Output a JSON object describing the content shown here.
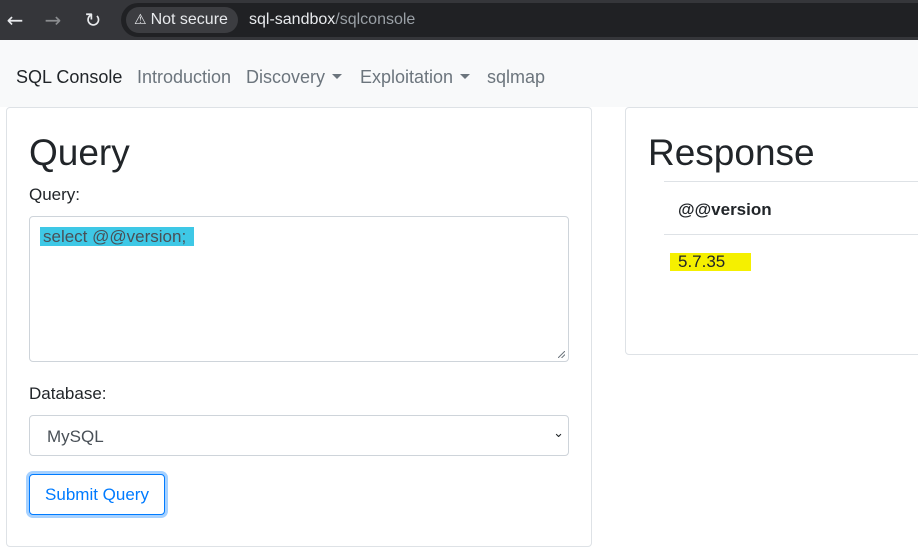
{
  "browser": {
    "back_icon": "arrow-left",
    "forward_icon": "arrow-right",
    "reload_icon": "reload",
    "security_label": "Not secure",
    "url_host": "sql-sandbox",
    "url_path": "/sqlconsole"
  },
  "navbar": {
    "brand": "SQL Console",
    "items": [
      {
        "label": "Introduction",
        "dropdown": false
      },
      {
        "label": "Discovery",
        "dropdown": true
      },
      {
        "label": "Exploitation",
        "dropdown": true
      },
      {
        "label": "sqlmap",
        "dropdown": false
      }
    ]
  },
  "query_card": {
    "title": "Query",
    "query_label": "Query:",
    "query_value": "select @@version;",
    "database_label": "Database:",
    "database_selected": "MySQL",
    "submit_label": "Submit Query"
  },
  "response_card": {
    "title": "Response",
    "columns": [
      "@@version"
    ],
    "rows": [
      [
        "5.7.35"
      ]
    ]
  },
  "colors": {
    "browser_bar": "#35363a",
    "navbar_bg": "#f8f9fa",
    "query_highlight": "#3ec8e6",
    "result_highlight": "#f5f000",
    "primary": "#007bff"
  }
}
